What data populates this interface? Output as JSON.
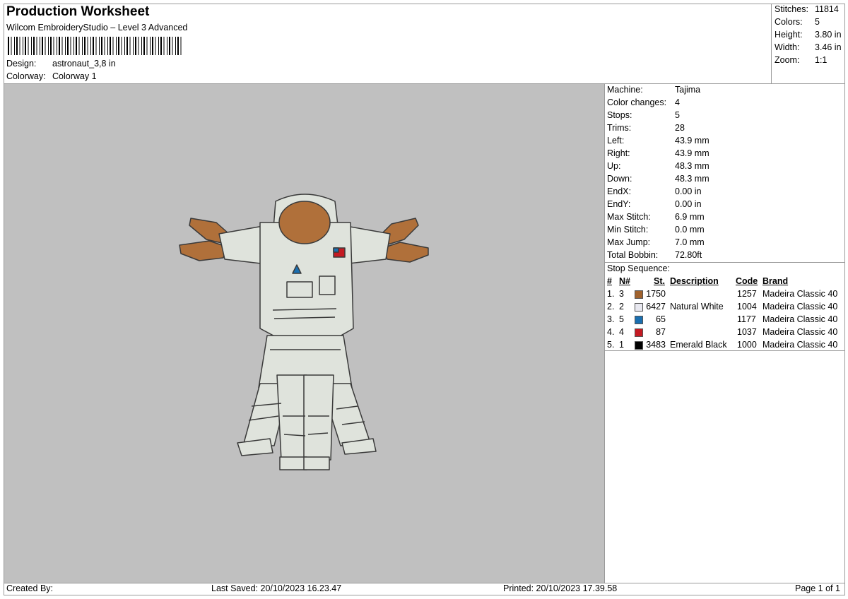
{
  "header": {
    "title": "Production Worksheet",
    "subtitle": "Wilcom EmbroideryStudio – Level 3 Advanced",
    "design_label": "Design:",
    "design_value": "astronaut_3,8 in",
    "colorway_label": "Colorway:",
    "colorway_value": "Colorway 1"
  },
  "stats": [
    {
      "label": "Stitches:",
      "value": "11814"
    },
    {
      "label": "Colors:",
      "value": "5"
    },
    {
      "label": "Height:",
      "value": "3.80 in"
    },
    {
      "label": "Width:",
      "value": "3.46 in"
    },
    {
      "label": "Zoom:",
      "value": "1:1"
    }
  ],
  "machine_info": [
    {
      "label": "Machine:",
      "value": "Tajima"
    },
    {
      "label": "Color changes:",
      "value": "4"
    },
    {
      "label": "Stops:",
      "value": "5"
    },
    {
      "label": "Trims:",
      "value": "28"
    },
    {
      "label": "Left:",
      "value": "43.9 mm"
    },
    {
      "label": "Right:",
      "value": "43.9 mm"
    },
    {
      "label": "Up:",
      "value": "48.3 mm"
    },
    {
      "label": "Down:",
      "value": "48.3 mm"
    },
    {
      "label": "EndX:",
      "value": "0.00 in"
    },
    {
      "label": "EndY:",
      "value": "0.00 in"
    },
    {
      "label": "Max Stitch:",
      "value": "6.9 mm"
    },
    {
      "label": "Min Stitch:",
      "value": "0.0 mm"
    },
    {
      "label": "Max Jump:",
      "value": "7.0 mm"
    },
    {
      "label": "Total Bobbin:",
      "value": "72.80ft"
    }
  ],
  "stop_sequence": {
    "title": "Stop Sequence:",
    "columns": [
      "#",
      "N#",
      "St.",
      "Description",
      "Code",
      "Brand"
    ],
    "rows": [
      {
        "idx": "1.",
        "n": "3",
        "color": "#a0622d",
        "st": "1750",
        "desc": "",
        "code": "1257",
        "brand": "Madeira Classic 40"
      },
      {
        "idx": "2.",
        "n": "2",
        "color": "#e8e8f0",
        "st": "6427",
        "desc": "Natural White",
        "code": "1004",
        "brand": "Madeira Classic 40"
      },
      {
        "idx": "3.",
        "n": "5",
        "color": "#1a6fb0",
        "st": "65",
        "desc": "",
        "code": "1177",
        "brand": "Madeira Classic 40"
      },
      {
        "idx": "4.",
        "n": "4",
        "color": "#c41a22",
        "st": "87",
        "desc": "",
        "code": "1037",
        "brand": "Madeira Classic 40"
      },
      {
        "idx": "5.",
        "n": "1",
        "color": "#000000",
        "st": "3483",
        "desc": "Emerald Black",
        "code": "1000",
        "brand": "Madeira Classic 40"
      }
    ]
  },
  "footer": {
    "created_by": "Created By:",
    "last_saved": "Last Saved: 20/10/2023 16.23.47",
    "printed": "Printed: 20/10/2023 17.39.58",
    "page": "Page 1 of 1"
  },
  "colors": {
    "preview_bg": "#c0c0c0",
    "suit": "#dfe3dc",
    "suit_outline": "#3a3a3a",
    "skin": "#b0703a"
  }
}
